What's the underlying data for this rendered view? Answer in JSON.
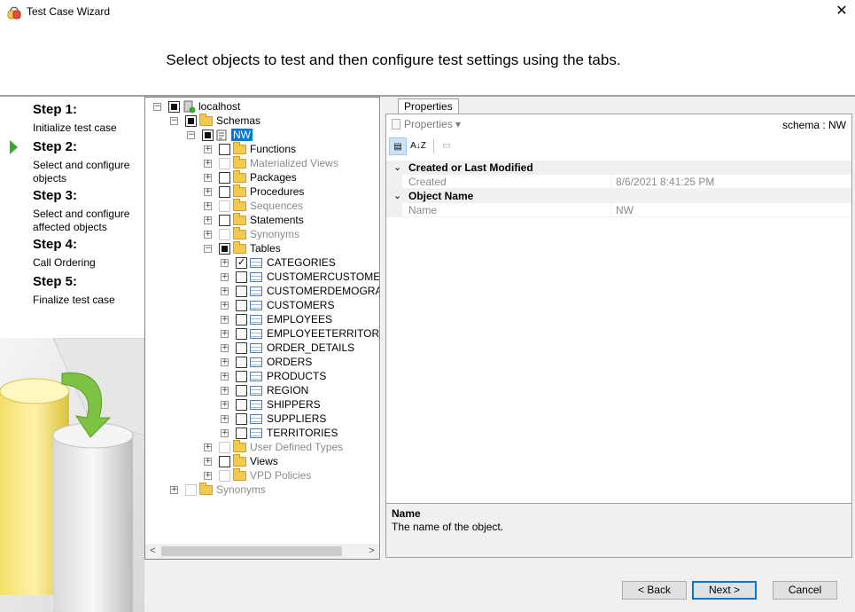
{
  "window": {
    "title": "Test Case Wizard",
    "close_glyph": "✕",
    "app_icon": "wizard-app-icon"
  },
  "header": {
    "instruction": "Select objects to test and then configure test settings using the tabs."
  },
  "steps": [
    {
      "title": "Step 1:",
      "description": "Initialize test case"
    },
    {
      "title": "Step 2:",
      "description": "Select and configure objects",
      "current": true
    },
    {
      "title": "Step 3:",
      "description": "Select and configure affected objects"
    },
    {
      "title": "Step 4:",
      "description": "Call Ordering"
    },
    {
      "title": "Step 5:",
      "description": "Finalize test case"
    }
  ],
  "tree": {
    "root": "localhost",
    "schemas": "Schemas",
    "schema_name": "NW",
    "folders": {
      "functions": "Functions",
      "materialized_views": "Materialized Views",
      "packages": "Packages",
      "procedures": "Procedures",
      "sequences": "Sequences",
      "statements": "Statements",
      "synonyms": "Synonyms",
      "tables": "Tables",
      "user_defined_types": "User Defined Types",
      "views": "Views",
      "vpd_policies": "VPD Policies",
      "root_synonyms": "Synonyms"
    },
    "tables": [
      "CATEGORIES",
      "CUSTOMERCUSTOMERDEMO",
      "CUSTOMERDEMOGRAPHICS",
      "CUSTOMERS",
      "EMPLOYEES",
      "EMPLOYEETERRITORIES",
      "ORDER_DETAILS",
      "ORDERS",
      "PRODUCTS",
      "REGION",
      "SHIPPERS",
      "SUPPLIERS",
      "TERRITORIES"
    ],
    "checked_glyph": "✓",
    "expander_glyph": "+",
    "collapse_glyph": "−",
    "scroll_left": "<",
    "scroll_right": ">"
  },
  "properties": {
    "tab_label": "Properties",
    "dropdown_label": "Properties",
    "dropdown_glyph": "▾",
    "context": "schema : NW",
    "sort_categorized_glyph": "▤",
    "sort_alpha_glyph": "A↓Z",
    "property_pages_glyph": "▭",
    "categories": [
      {
        "name": "Created or Last Modified",
        "rows": [
          {
            "name": "Created",
            "value": "8/6/2021 8:41:25 PM"
          }
        ]
      },
      {
        "name": "Object Name",
        "rows": [
          {
            "name": "Name",
            "value": "NW"
          }
        ]
      }
    ],
    "collapse_glyph": "⌄",
    "description": {
      "title": "Name",
      "text": "The name of the object."
    }
  },
  "buttons": {
    "back": "< Back",
    "next": "Next >",
    "cancel": "Cancel"
  },
  "colors": {
    "accent": "#0078d7",
    "step_arrow": "#3aa82c",
    "folder": "#f2c94c"
  }
}
